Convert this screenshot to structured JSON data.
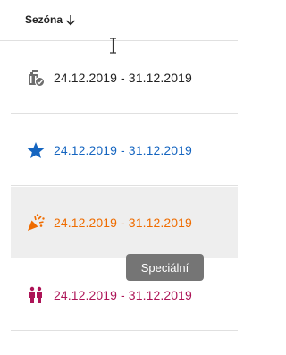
{
  "header": {
    "column_label": "Sezóna",
    "sort_icon": "arrow-down-icon"
  },
  "rows": [
    {
      "icon": "luggage-check-icon",
      "date_range": "24.12.2019 - 31.12.2019",
      "color": "#222222"
    },
    {
      "icon": "star-icon",
      "date_range": "24.12.2019 - 31.12.2019",
      "color": "#1565c0"
    },
    {
      "icon": "party-popper-icon",
      "date_range": "24.12.2019 - 31.12.2019",
      "color": "#ef6c00"
    },
    {
      "icon": "people-icon",
      "date_range": "24.12.2019 - 31.12.2019",
      "color": "#ad1457"
    }
  ],
  "tooltip": {
    "text": "Speciální"
  },
  "colors": {
    "divider": "#e0e0e0",
    "hover_row": "#eeeeee",
    "tooltip_bg": "#757575"
  }
}
